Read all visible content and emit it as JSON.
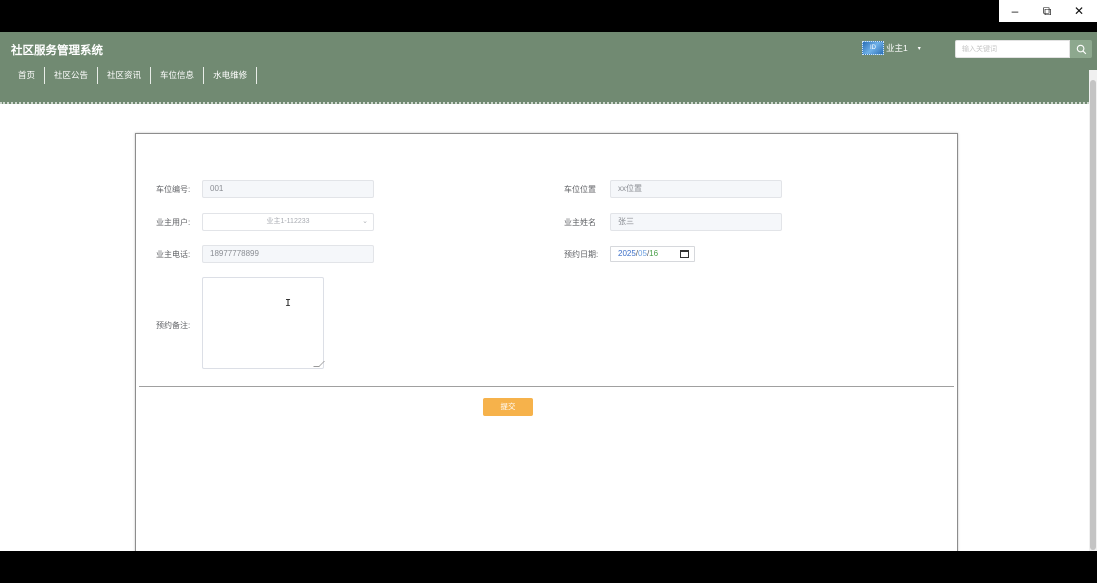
{
  "window": {
    "minimize_icon": "minimize-icon",
    "restore_icon": "restore-icon",
    "close_icon": "close-icon"
  },
  "header": {
    "site_title": "社区服务管理系统",
    "nav": [
      "首页",
      "社区公告",
      "社区资讯",
      "车位信息",
      "水电维修"
    ],
    "user": {
      "avatar_text": "ID",
      "name": "业主1",
      "caret": "▾"
    },
    "search": {
      "placeholder": "输入关键词"
    },
    "colors": {
      "header_bg": "#718a72",
      "submit": "#f6b24b"
    }
  },
  "form": {
    "parking_no": {
      "label": "车位编号:",
      "value": "001"
    },
    "parking_location": {
      "label": "车位位置",
      "value": "xx位置"
    },
    "owner_user": {
      "label": "业主用户:",
      "value": "业主1-112233"
    },
    "owner_name": {
      "label": "业主姓名",
      "value": "张三"
    },
    "owner_phone": {
      "label": "业主电话:",
      "value": "18977778899"
    },
    "reserve_date": {
      "label": "预约日期:",
      "year": "2025",
      "month": "05",
      "day": "16",
      "sep": "/"
    },
    "remark": {
      "label": "预约备注:",
      "value": ""
    },
    "submit_label": "提交"
  }
}
